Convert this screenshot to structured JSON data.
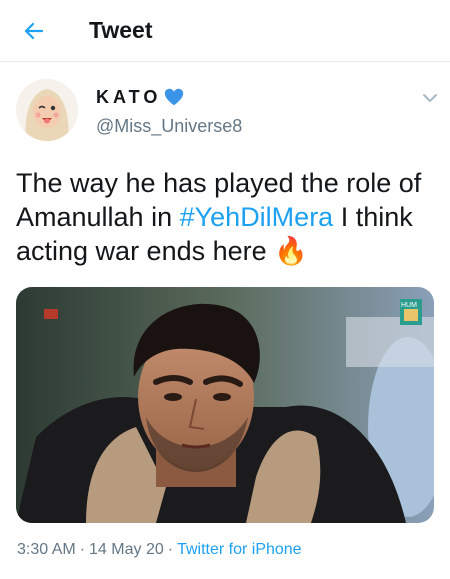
{
  "header": {
    "title": "Tweet"
  },
  "author": {
    "display_name": "KATO",
    "handle": "@Miss_Universe8"
  },
  "tweet": {
    "text_before": "The way he has played the role of Amanullah in ",
    "hashtag": "#YehDilMera",
    "text_after": " I think acting war ends here ",
    "emoji": "🔥"
  },
  "media": {
    "channel_logo_text": "HUM"
  },
  "meta": {
    "time": "3:30 AM",
    "date": "14 May 20",
    "source": "Twitter for iPhone"
  },
  "colors": {
    "accent": "#1da1f2",
    "secondary_text": "#657786",
    "primary_text": "#14171a"
  },
  "icons": [
    "back-arrow-icon",
    "verified-badge-icon",
    "chevron-down-icon",
    "fire-emoji"
  ]
}
